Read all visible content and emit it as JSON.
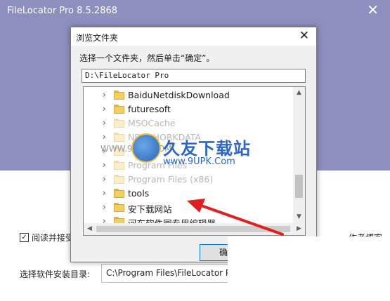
{
  "installer": {
    "title": "FileLocator Pro 8.5.2868",
    "close_glyph": "✕",
    "agree_label": "阅读并接受",
    "right_text": "作者博客",
    "dir_label": "选择软件安装目录:",
    "dir_value": "C:\\Program Files\\FileLocator Pro"
  },
  "dialog": {
    "title": "浏览文件夹",
    "close_glyph": "✕",
    "instruction": "选择一个文件夹，然后单击“确定”。",
    "path_value": "D:\\FileLocator Pro",
    "tree_items": [
      {
        "label": "BaiduNetdiskDownload",
        "dim": false
      },
      {
        "label": "futuresoft",
        "dim": false
      },
      {
        "label": "MSOCache",
        "dim": true
      },
      {
        "label": "NDRSHORKDATA",
        "dim": true
      },
      {
        "label": "",
        "dim": true
      },
      {
        "label": "Program Files",
        "dim": true
      },
      {
        "label": "Program Files (x86)",
        "dim": true
      },
      {
        "label": "tools",
        "dim": false
      },
      {
        "label": "安下载网站",
        "dim": false
      },
      {
        "label": "河东软件园专用编辑器",
        "dim": false
      }
    ],
    "ok_label": "确定"
  },
  "watermark": {
    "brand": "久友下载站",
    "url": "www.9UPK.Com",
    "left_text": "WWW.9UPK.COM"
  },
  "colors": {
    "header_bg": "#8d8fbf",
    "annotation_arrow": "#e02020",
    "folder": "#f3cf62"
  }
}
